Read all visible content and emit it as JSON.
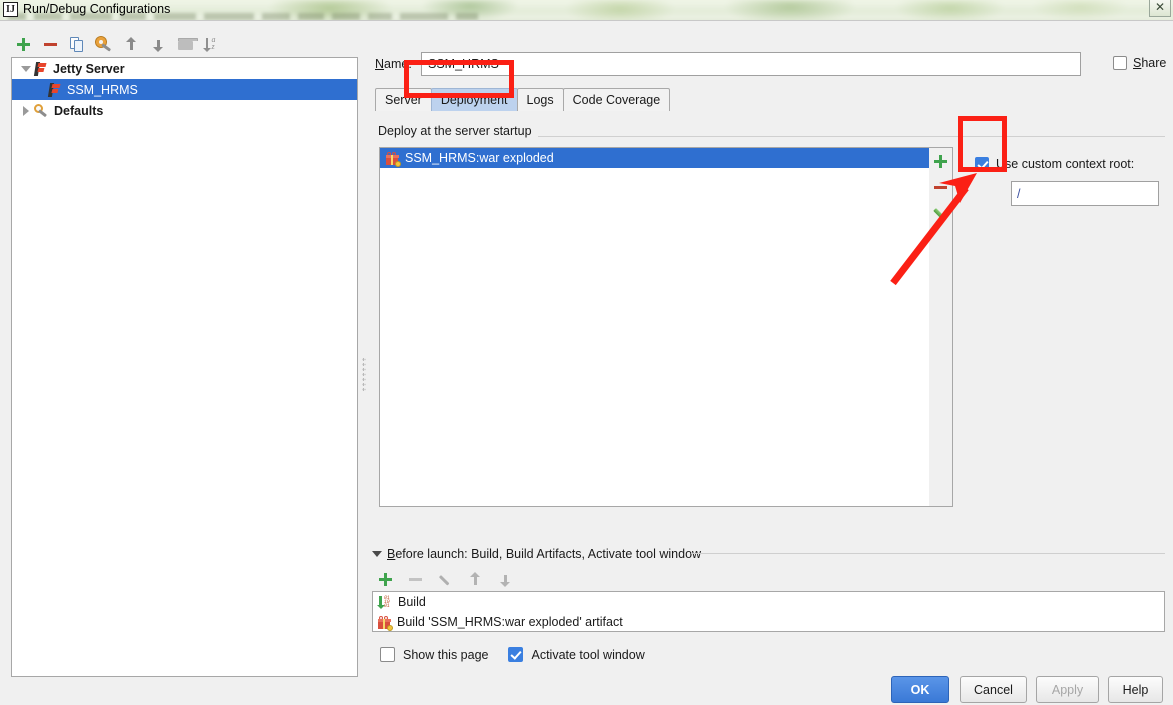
{
  "window": {
    "title": "Run/Debug Configurations",
    "app_icon": "intellij-idea-icon",
    "close_label": "✕"
  },
  "left_toolbar": {
    "buttons": [
      {
        "name": "add-configuration-button",
        "icon": "plus-icon"
      },
      {
        "name": "remove-configuration-button",
        "icon": "minus-icon"
      },
      {
        "name": "copy-configuration-button",
        "icon": "copy-icon"
      },
      {
        "name": "edit-templates-button",
        "icon": "wrench-icon"
      },
      {
        "name": "move-up-button",
        "icon": "arrow-up-icon"
      },
      {
        "name": "move-down-button",
        "icon": "arrow-down-icon"
      },
      {
        "name": "create-folder-button",
        "icon": "folder-icon"
      },
      {
        "name": "sort-alphabetically-button",
        "icon": "sort-az-icon"
      }
    ]
  },
  "tree": {
    "items": [
      {
        "label": "Jetty Server",
        "icon": "jetty-icon",
        "expanded": true,
        "selected": false,
        "bold": true,
        "indent": 0
      },
      {
        "label": "SSM_HRMS",
        "icon": "jetty-icon",
        "expanded": null,
        "selected": true,
        "bold": false,
        "indent": 1
      },
      {
        "label": "Defaults",
        "icon": "wrench-icon",
        "expanded": false,
        "selected": false,
        "bold": true,
        "indent": 0
      }
    ]
  },
  "name_field": {
    "label": "Name:",
    "label_mnemonic": "N",
    "label_rest": "ame:",
    "value": "SSM_HRMS",
    "placeholder": ""
  },
  "share": {
    "label_mnemonic": "S",
    "label_rest": "hare",
    "label": "Share",
    "checked": false
  },
  "tabs": [
    {
      "label": "Server",
      "active": false
    },
    {
      "label": "Deployment",
      "active": true
    },
    {
      "label": "Logs",
      "active": false
    },
    {
      "label": "Code Coverage",
      "active": false
    }
  ],
  "deployment": {
    "group_title": "Deploy at the server startup",
    "rows": [
      {
        "label": "SSM_HRMS:war exploded",
        "icon": "artifact-icon",
        "selected": true
      }
    ],
    "sidebar_buttons": [
      {
        "name": "add-artifact-button",
        "icon": "plus-icon"
      },
      {
        "name": "remove-artifact-button",
        "icon": "minus-icon"
      },
      {
        "name": "edit-artifact-button",
        "icon": "pencil-icon"
      }
    ],
    "custom_context_root": {
      "label": "Use custom context root:",
      "checked": true,
      "value": "/",
      "placeholder": ""
    }
  },
  "before_launch": {
    "title": "Before launch: Build, Build Artifacts, Activate tool window",
    "title_mnemonic": "B",
    "title_rest": "efore launch: Build, Build Artifacts, Activate tool window",
    "toolbar": [
      {
        "name": "add-task-button",
        "icon": "plus-icon",
        "enabled": true
      },
      {
        "name": "remove-task-button",
        "icon": "minus-icon",
        "enabled": false
      },
      {
        "name": "edit-task-button",
        "icon": "pencil-icon",
        "enabled": false
      },
      {
        "name": "task-move-up-button",
        "icon": "arrow-up-icon",
        "enabled": false
      },
      {
        "name": "task-move-down-button",
        "icon": "arrow-down-icon",
        "enabled": false
      }
    ],
    "tasks": [
      {
        "label": "Build",
        "icon": "build-icon"
      },
      {
        "label": "Build 'SSM_HRMS:war exploded' artifact",
        "icon": "artifact-icon"
      }
    ],
    "show_this_page": {
      "label": "Show this page",
      "checked": false
    },
    "activate_tool_window": {
      "label": "Activate tool window",
      "checked": true
    }
  },
  "dialog_buttons": [
    {
      "label": "OK",
      "style": "primary",
      "enabled": true
    },
    {
      "label": "Cancel",
      "style": "default",
      "enabled": true
    },
    {
      "label": "Apply",
      "style": "default",
      "enabled": false
    },
    {
      "label": "Help",
      "style": "default",
      "enabled": true
    }
  ],
  "annotations": {
    "color": "#fb2015",
    "highlight_tab": "Deployment",
    "highlight_checkbox": "Use custom context root:",
    "arrow_points_to": "use-custom-context-root-checkbox"
  },
  "colors": {
    "selection_blue": "#2f6fd0",
    "accent_primary": "#3a79d6",
    "annotation_red": "#fb2015",
    "active_tab": "#bdd2ee",
    "dialog_bg": "#f0f0f0"
  }
}
